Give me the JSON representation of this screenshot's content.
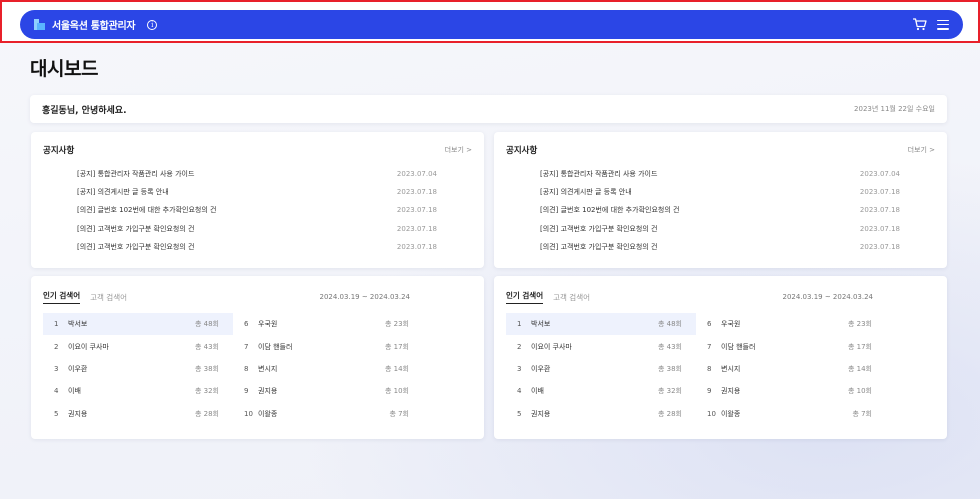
{
  "header": {
    "app_title": "서울옥션 통합관리자",
    "info_glyph": "i",
    "icons": [
      "logo-icon",
      "info-icon",
      "cart-icon",
      "menu-icon"
    ],
    "accent_color": "#2b46e6"
  },
  "page": {
    "title": "대시보드"
  },
  "welcome": {
    "greeting": "홍길동님, 안녕하세요.",
    "date": "2023년 11월 22일 수요일"
  },
  "notices": [
    {
      "title": "공지사항",
      "more": "더보기 >",
      "items": [
        {
          "text": "[공지] 통합관리자 작품관리 사용 가이드",
          "date": "2023.07.04"
        },
        {
          "text": "[공지] 의견게시판 글 등록 안내",
          "date": "2023.07.18"
        },
        {
          "text": "[의견] 글번호 102번에 대한 추가확인요청의 건",
          "date": "2023.07.18"
        },
        {
          "text": "[의견] 고객번호 가입구분 확인요청의 건",
          "date": "2023.07.18"
        },
        {
          "text": "[의견] 고객번호 가입구분 확인요청의 건",
          "date": "2023.07.18"
        }
      ]
    },
    {
      "title": "공지사항",
      "more": "더보기 >",
      "items": [
        {
          "text": "[공지] 통합관리자 작품관리 사용 가이드",
          "date": "2023.07.04"
        },
        {
          "text": "[공지] 의견게시판 글 등록 안내",
          "date": "2023.07.18"
        },
        {
          "text": "[의견] 글번호 102번에 대한 추가확인요청의 건",
          "date": "2023.07.18"
        },
        {
          "text": "[의견] 고객번호 가입구분 확인요청의 건",
          "date": "2023.07.18"
        },
        {
          "text": "[의견] 고객번호 가입구분 확인요청의 건",
          "date": "2023.07.18"
        }
      ]
    }
  ],
  "searches": [
    {
      "tabs": [
        "인기 검색어",
        "고객 검색어"
      ],
      "active_tab": 0,
      "range": "2024.03.19 ~ 2024.03.24",
      "ranks": [
        {
          "n": "1",
          "keyword": "박서보",
          "count": "총 48회"
        },
        {
          "n": "2",
          "keyword": "이요이 쿠사마",
          "count": "총 43회"
        },
        {
          "n": "3",
          "keyword": "이우환",
          "count": "총 38회"
        },
        {
          "n": "4",
          "keyword": "이배",
          "count": "총 32회"
        },
        {
          "n": "5",
          "keyword": "권지용",
          "count": "총 28회"
        },
        {
          "n": "6",
          "keyword": "우국원",
          "count": "총 23회"
        },
        {
          "n": "7",
          "keyword": "이담 핸들러",
          "count": "총 17회"
        },
        {
          "n": "8",
          "keyword": "변시지",
          "count": "총 14회"
        },
        {
          "n": "9",
          "keyword": "권지용",
          "count": "총 10회"
        },
        {
          "n": "10",
          "keyword": "이왈종",
          "count": "총 7회"
        }
      ]
    },
    {
      "tabs": [
        "인기 검색어",
        "고객 검색어"
      ],
      "active_tab": 0,
      "range": "2024.03.19 ~ 2024.03.24",
      "ranks": [
        {
          "n": "1",
          "keyword": "박서보",
          "count": "총 48회"
        },
        {
          "n": "2",
          "keyword": "이요이 쿠사마",
          "count": "총 43회"
        },
        {
          "n": "3",
          "keyword": "이우환",
          "count": "총 38회"
        },
        {
          "n": "4",
          "keyword": "이배",
          "count": "총 32회"
        },
        {
          "n": "5",
          "keyword": "권지용",
          "count": "총 28회"
        },
        {
          "n": "6",
          "keyword": "우국원",
          "count": "총 23회"
        },
        {
          "n": "7",
          "keyword": "이담 핸들러",
          "count": "총 17회"
        },
        {
          "n": "8",
          "keyword": "변시지",
          "count": "총 14회"
        },
        {
          "n": "9",
          "keyword": "권지용",
          "count": "총 10회"
        },
        {
          "n": "10",
          "keyword": "이왈종",
          "count": "총 7회"
        }
      ]
    }
  ]
}
